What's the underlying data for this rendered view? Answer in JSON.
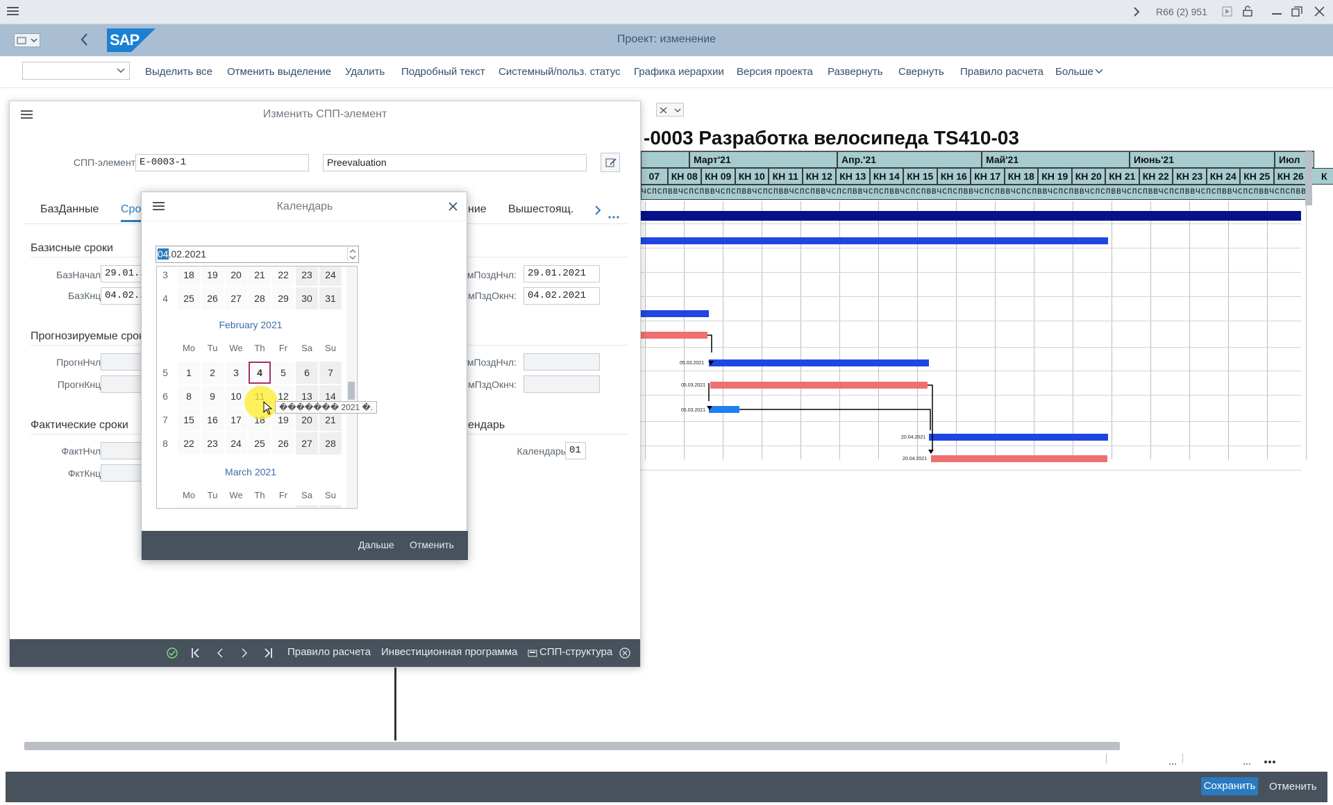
{
  "system": {
    "session": "R66 (2) 951"
  },
  "shell": {
    "title": "Проект: изменение",
    "logo": "SAP"
  },
  "toolbar": {
    "buttons": [
      "Выделить все",
      "Отменить выделение",
      "Удалить",
      "Подробный текст",
      "Системный/польз. статус",
      "Графика иерархии",
      "Версия проекта",
      "Развернуть",
      "Свернуть",
      "Правило расчета",
      "Больше"
    ]
  },
  "dialog": {
    "title": "Изменить СПП-элемент",
    "wbs_label": "СПП-элемент:",
    "wbs_value": "E-0003-1",
    "wbs_desc": "Preevaluation",
    "tabs": [
      "БазДанные",
      "Сро",
      "ние",
      "Вышестоящ."
    ],
    "sec_basic": "Базисные сроки",
    "bazstart_label": "БазНачал:",
    "bazstart_value": "29.01.2",
    "bazend_label": "БазКнц:",
    "bazend_value": "04.02.2",
    "late_start_label": "амПоздНчл:",
    "late_start_value": "29.01.2021",
    "late_end_label": "СмПздОкнч:",
    "late_end_value": "04.02.2021",
    "sec_forecast": "Прогнозируемые срок",
    "fc_start_label": "ПрогнНчл:",
    "fc_end_label": "ПрогнКнц:",
    "fc_late_start_label": "амПоздНчл:",
    "fc_late_end_label": "СмПздОкнч:",
    "sec_actual": "Фактические сроки",
    "act_start_label": "ФактНчл:",
    "act_end_label": "ФктКнц:",
    "sec_calendar": "ендарь",
    "calendar_label": "Календарь:",
    "calendar_value": "01",
    "footer": [
      "Правило расчета",
      "Инвестиционная программа",
      "СПП-структура"
    ]
  },
  "calendar": {
    "title": "Календарь",
    "input_sel": "04",
    "input_rest": ".02.2021",
    "weekday_labels": [
      "Mo",
      "Tu",
      "We",
      "Th",
      "Fr",
      "Sa",
      "Su"
    ],
    "jan_rows": [
      {
        "week": "3",
        "days": [
          "18",
          "19",
          "20",
          "21",
          "22",
          "23",
          "24"
        ]
      },
      {
        "week": "4",
        "days": [
          "25",
          "26",
          "27",
          "28",
          "29",
          "30",
          "31"
        ]
      }
    ],
    "feb_name": "February 2021",
    "feb_rows": [
      {
        "week": "5",
        "days": [
          "1",
          "2",
          "3",
          "4",
          "5",
          "6",
          "7"
        ]
      },
      {
        "week": "6",
        "days": [
          "8",
          "9",
          "10",
          "11",
          "12",
          "13",
          "14"
        ]
      },
      {
        "week": "7",
        "days": [
          "15",
          "16",
          "17",
          "18",
          "19",
          "20",
          "21"
        ]
      },
      {
        "week": "8",
        "days": [
          "22",
          "23",
          "24",
          "25",
          "26",
          "27",
          "28"
        ]
      }
    ],
    "mar_name": "March 2021",
    "tooltip": "������� 2021 �.",
    "next": "Дальше",
    "cancel": "Отменить"
  },
  "gantt": {
    "title": "-0003    Разработка велосипеда TS410-03",
    "months": [
      "Март'21",
      "Апр.'21",
      "Май'21",
      "Июнь'21",
      "Июл"
    ],
    "weeks": [
      "07",
      "КН 08",
      "КН 09",
      "КН 10",
      "КН 11",
      "КН 12",
      "КН 13",
      "КН 14",
      "КН 15",
      "КН 16",
      "КН 17",
      "КН 18",
      "КН 19",
      "КН 20",
      "КН 21",
      "КН 22",
      "КН 23",
      "КН 24",
      "КН 25",
      "КН 26",
      "К"
    ],
    "days": "ЧСПСПВВЧСПСПВВЧСПСПВВЧСПСПВВЧСПСПВВЧСПСПВВЧСПСПВВЧСПСПВВЧСПСПВВЧСПСПВВЧСПСПВВЧСПСПВВЧСПСПВВЧСПСПВВЧСПСПВВЧСПСПВВЧСПСПВВЧСПСПВВЧСПСПВВЧСПСПВВЧСПСПВВ",
    "date_labels": [
      "05.03.2021",
      "05.03.2021",
      "05.03.2021",
      "20.04.2021",
      "20.04.2021"
    ]
  },
  "bottom": {
    "save": "Сохранить",
    "cancel": "Отменить"
  },
  "colors": {
    "shell": "#a9bed3",
    "footer": "#47525c",
    "gantt_header": "#a6cccf",
    "bar_blue": "#1f46e0",
    "bar_red": "#f07070"
  }
}
